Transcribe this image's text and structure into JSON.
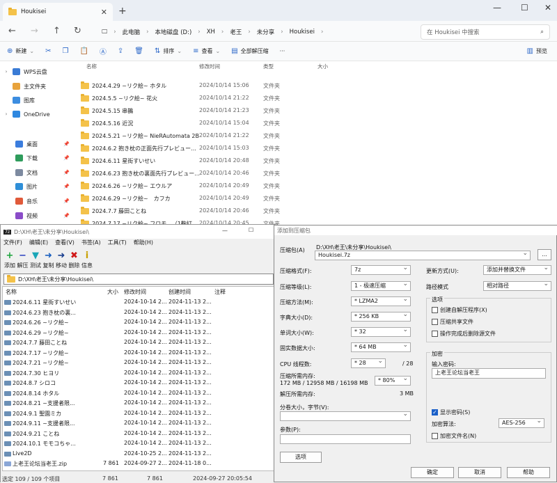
{
  "explorer": {
    "tab_title": "Houkisei",
    "breadcrumb": [
      "此电脑",
      "本地磁盘 (D:)",
      "XH",
      "老王",
      "未分享",
      "Houkisei"
    ],
    "search_placeholder": "在 Houkisei 中搜索",
    "commands": {
      "new": "新建",
      "sort": "排序",
      "view": "查看",
      "extract_all": "全部解压缩",
      "preview": "预览"
    },
    "nav": [
      {
        "label": "WPS云盘",
        "color": "#3a7bd5"
      },
      {
        "label": "主文件夹",
        "color": "#e8a33c"
      },
      {
        "label": "图库",
        "color": "#3c8de0"
      },
      {
        "label": "OneDrive",
        "color": "#2f88e0"
      },
      {
        "label": "桌面",
        "color": "#3b7ddd"
      },
      {
        "label": "下载",
        "color": "#2f9c5c"
      },
      {
        "label": "文档",
        "color": "#7d8aa0"
      },
      {
        "label": "图片",
        "color": "#2f8fd8"
      },
      {
        "label": "音乐",
        "color": "#e05a3a"
      },
      {
        "label": "视频",
        "color": "#8a4cc8"
      }
    ],
    "columns": {
      "name": "名称",
      "modified": "修改时间",
      "type": "类型",
      "size": "大小"
    },
    "files": [
      {
        "name": "2024.4.29 ~リク絵~ ホタル",
        "date": "2024/10/14 15:06",
        "type": "文件夹"
      },
      {
        "name": "2024.5.5 ~リク絵~ 花火",
        "date": "2024/10/14 21:22",
        "type": "文件夹"
      },
      {
        "name": "2024.5.15 串鵲",
        "date": "2024/10/14 21:23",
        "type": "文件夹"
      },
      {
        "name": "2024.5.16 近況",
        "date": "2024/10/14 15:04",
        "type": "文件夹"
      },
      {
        "name": "2024.5.21 ~リク絵~ NieRAutomata  2B",
        "date": "2024/10/14 21:22",
        "type": "文件夹"
      },
      {
        "name": "2024.6.2 抱き枕の正面先行プレビュー...",
        "date": "2024/10/14 15:03",
        "type": "文件夹"
      },
      {
        "name": "2024.6.11 星街すいせい",
        "date": "2024/10/14 20:48",
        "type": "文件夹"
      },
      {
        "name": "2024.6.23 抱き枕の裏面先行プレビュー...",
        "date": "2024/10/14 20:46",
        "type": "文件夹"
      },
      {
        "name": "2024.6.26 ~リク絵~ エウルア",
        "date": "2024/10/14 20:49",
        "type": "文件夹"
      },
      {
        "name": "2024.6.29 ~リク絵~　カフカ",
        "date": "2024/10/14 20:49",
        "type": "文件夹"
      },
      {
        "name": "2024.7.7 藤田ことね",
        "date": "2024/10/14 20:46",
        "type": "文件夹"
      },
      {
        "name": "2024.7.17 ~リク絵~ フロモ...（1鞠打",
        "date": "2024/10/14 20:45",
        "type": "文件夹"
      }
    ]
  },
  "sevenzip": {
    "title": "D:\\XH\\老王\\未分享\\Houkisei\\",
    "menu": [
      "文件(F)",
      "编辑(E)",
      "查看(V)",
      "书签(A)",
      "工具(T)",
      "帮助(H)"
    ],
    "toolbar": [
      "添加",
      "解压",
      "测试",
      "复制",
      "移动",
      "删除",
      "信息"
    ],
    "path": "D:\\XH\\老王\\未分享\\Houkisei\\",
    "columns": {
      "name": "名称",
      "size": "大小",
      "modified": "修改时间",
      "created": "创建时间",
      "comment": "注释"
    },
    "rows": [
      {
        "name": "2024.6.11 星街すいせい",
        "size": "",
        "mod": "2024-10-14 2...",
        "cre": "2024-11-13 2..."
      },
      {
        "name": "2024.6.23 抱き枕の裏...",
        "size": "",
        "mod": "2024-10-14 2...",
        "cre": "2024-11-13 2..."
      },
      {
        "name": "2024.6.26 ~リク絵~",
        "size": "",
        "mod": "2024-10-14 2...",
        "cre": "2024-11-13 2..."
      },
      {
        "name": "2024.6.29 ~リク絵~",
        "size": "",
        "mod": "2024-10-14 2...",
        "cre": "2024-11-13 2..."
      },
      {
        "name": "2024.7.7 藤田ことね",
        "size": "",
        "mod": "2024-10-14 2...",
        "cre": "2024-11-13 2..."
      },
      {
        "name": "2024.7.17 ~リク絵~",
        "size": "",
        "mod": "2024-10-14 2...",
        "cre": "2024-11-13 2..."
      },
      {
        "name": "2024.7.21 ~リク絵~",
        "size": "",
        "mod": "2024-10-14 2...",
        "cre": "2024-11-13 2..."
      },
      {
        "name": "2024.7.30 ヒヨリ",
        "size": "",
        "mod": "2024-10-14 2...",
        "cre": "2024-11-13 2..."
      },
      {
        "name": "2024.8.7 シロコ",
        "size": "",
        "mod": "2024-10-14 2...",
        "cre": "2024-11-13 2..."
      },
      {
        "name": "2024.8.14 ホタル",
        "size": "",
        "mod": "2024-10-14 2...",
        "cre": "2024-11-13 2..."
      },
      {
        "name": "2024.8.21 ~支援者限...",
        "size": "",
        "mod": "2024-10-14 2...",
        "cre": "2024-11-13 2..."
      },
      {
        "name": "2024.9.1 聖園ミカ",
        "size": "",
        "mod": "2024-10-14 2...",
        "cre": "2024-11-13 2..."
      },
      {
        "name": "2024.9.11 ~支援者限...",
        "size": "",
        "mod": "2024-10-14 2...",
        "cre": "2024-11-13 2..."
      },
      {
        "name": "2024.9.21 ことね",
        "size": "",
        "mod": "2024-10-14 2...",
        "cre": "2024-11-13 2..."
      },
      {
        "name": "2024.10.1 モモコちゃ...",
        "size": "",
        "mod": "2024-10-14 2...",
        "cre": "2024-11-13 2..."
      },
      {
        "name": "Live2D",
        "size": "",
        "mod": "2024-10-25 2...",
        "cre": "2024-11-13 2..."
      },
      {
        "name": "上老王论坛当老王.zip",
        "size": "7 861",
        "mod": "2024-09-27 2...",
        "cre": "2024-11-18 0..."
      }
    ],
    "status": {
      "selected": "选定 109 / 109 个项目",
      "size1": "7 861",
      "size2": "7 861",
      "date": "2024-09-27 20:05:54"
    }
  },
  "dialog": {
    "title": "添加到压缩包",
    "archive_label": "压缩包(A)",
    "archive_dir": "D:\\XH\\老王\\未分享\\Houkisei\\",
    "archive_name": "Houkisei.7z",
    "browse": "...",
    "format_label": "压缩格式(F):",
    "format": "7z",
    "level_label": "压缩等级(L):",
    "level": "1 - 极速压缩",
    "method_label": "压缩方法(M):",
    "method": "* LZMA2",
    "dict_label": "字典大小(D):",
    "dict": "* 256 KB",
    "word_label": "单词大小(W):",
    "word": "* 32",
    "solid_label": "固实数据大小:",
    "solid": "* 64 MB",
    "threads_label": "CPU 线程数:",
    "threads": "* 28",
    "threads_max": "/ 28",
    "mem_label": "压缩所需内存:",
    "mem_value": "172 MB / 12958 MB / 16198 MB",
    "mem_pct": "* 80%",
    "decomp_label": "解压所需内存:",
    "decomp_value": "3 MB",
    "split_label": "分卷大小，字节(V):",
    "params_label": "参数(P):",
    "options_btn": "选项",
    "update_label": "更新方式(U):",
    "update": "添加并替换文件",
    "pathmode_label": "路径模式",
    "pathmode": "相对路径",
    "options_group": "选项",
    "opt_sfx": "创建自解压程序(X)",
    "opt_shared": "压缩共享文件",
    "opt_delete": "操作完成后删除源文件",
    "enc_group": "加密",
    "pwd_label": "输入密码:",
    "pwd": "上老王论坛当老王",
    "show_pwd": "显示密码(S)",
    "enc_method_label": "加密算法:",
    "enc_method": "AES-256",
    "enc_names": "加密文件名(N)",
    "ok": "确定",
    "cancel": "取消",
    "help": "帮助"
  }
}
